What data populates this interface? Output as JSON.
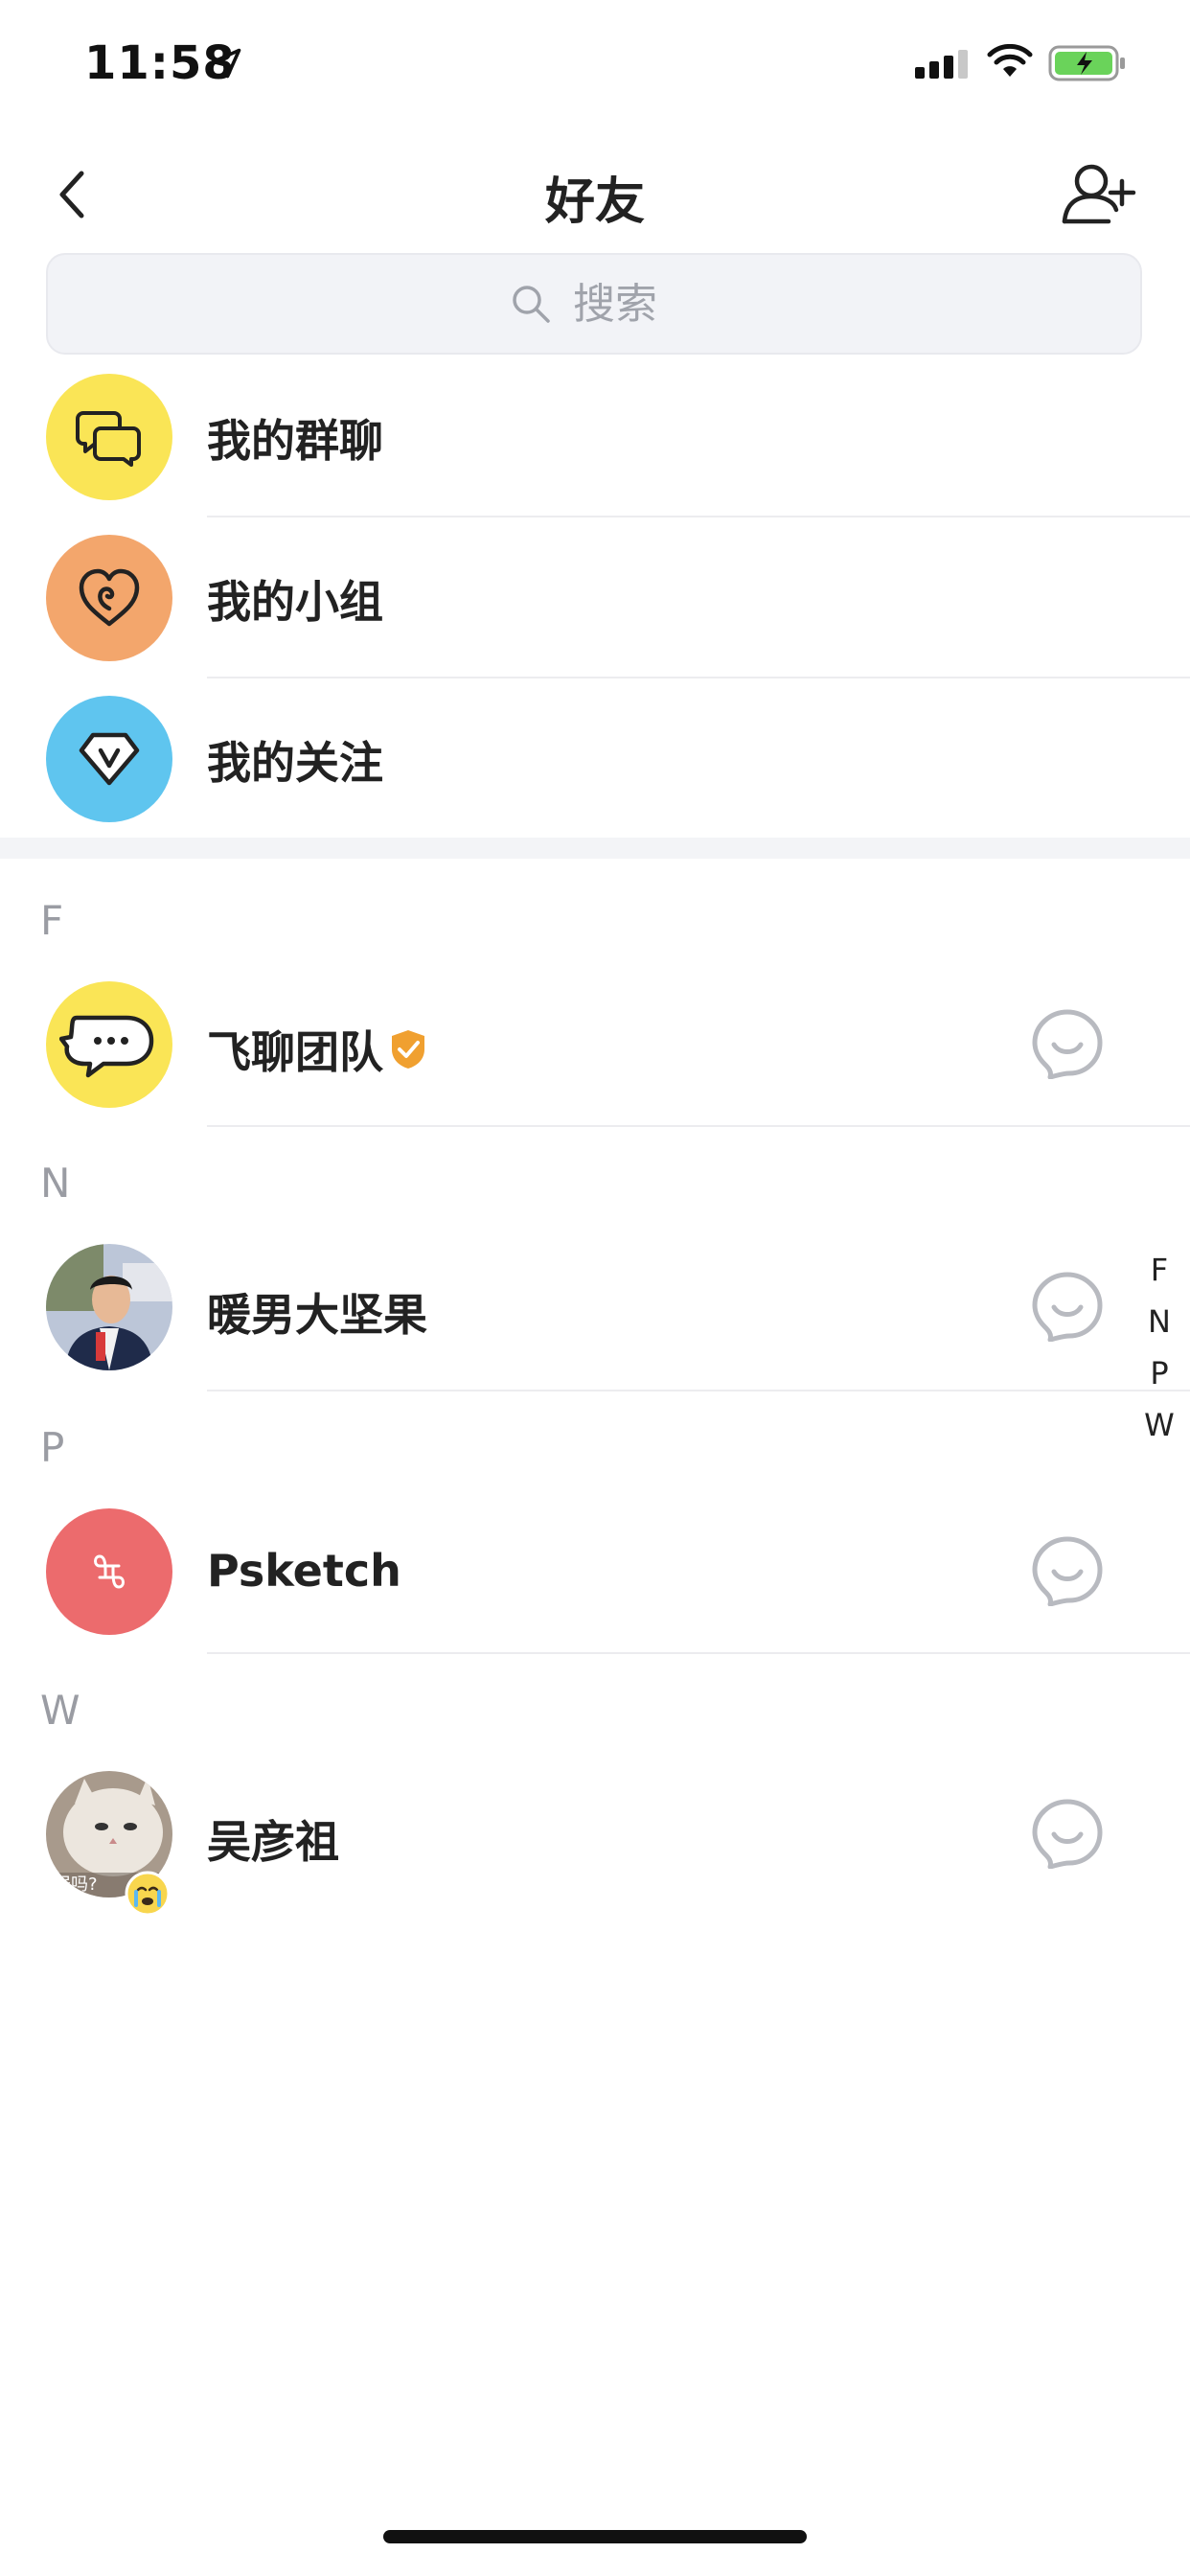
{
  "status_bar": {
    "time": "11:58",
    "icons": [
      "location-arrow-icon",
      "cellular-signal-icon",
      "wifi-icon",
      "battery-charging-icon"
    ]
  },
  "nav": {
    "title": "好友",
    "back_icon": "chevron-left-icon",
    "add_icon": "add-user-icon"
  },
  "search": {
    "placeholder": "搜索",
    "icon": "search-icon"
  },
  "menu": [
    {
      "label": "我的群聊",
      "icon": "chat-bubbles-icon",
      "color": "#fae556"
    },
    {
      "label": "我的小组",
      "icon": "heart-swirl-icon",
      "color": "#f3a66c"
    },
    {
      "label": "我的关注",
      "icon": "diamond-v-icon",
      "color": "#5fc5ef"
    }
  ],
  "sections": [
    {
      "letter": "F",
      "friends": [
        {
          "name": "飞聊团队",
          "verified": true,
          "avatar": "feiliao-logo-icon"
        }
      ]
    },
    {
      "letter": "N",
      "friends": [
        {
          "name": "暖男大坚果",
          "avatar": "photo-man-in-suit"
        }
      ]
    },
    {
      "letter": "P",
      "friends": [
        {
          "name": "Psketch",
          "avatar": "psketch-logo-icon",
          "avatar_color": "#ec6b6d"
        }
      ]
    },
    {
      "letter": "W",
      "friends": [
        {
          "name": "吴彦祖",
          "avatar": "photo-cat",
          "avatar_caption": "居吗?"
        }
      ]
    }
  ],
  "index_bar": [
    "F",
    "N",
    "P",
    "W"
  ],
  "colors": {
    "accent_yellow": "#fae556",
    "verified_orange": "#f0a030",
    "icon_gray": "#b8bac0",
    "separator": "#ececef"
  }
}
